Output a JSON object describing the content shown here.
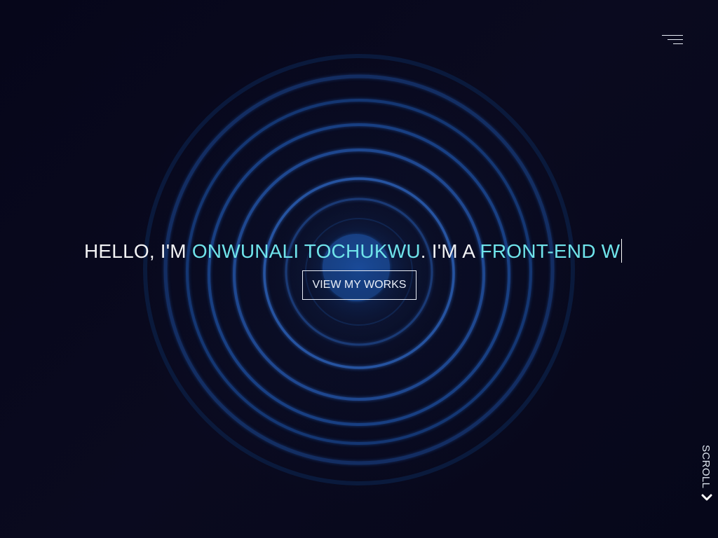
{
  "hero": {
    "intro": "HELLO, I'M ",
    "name": "ONWUNALI TOCHUKWU",
    "middle": ". I'M A ",
    "role": "FRONT-END W",
    "cta_label": "VIEW MY WORKS"
  },
  "menu": {
    "icon": "hamburger-menu-icon"
  },
  "scroll": {
    "label": "SCROLL",
    "icon": "chevron-down-icon"
  },
  "colors": {
    "background": "#07071a",
    "accent": "#6fe3ea",
    "text": "#f2f2f4",
    "ring": "#1a4a99"
  }
}
